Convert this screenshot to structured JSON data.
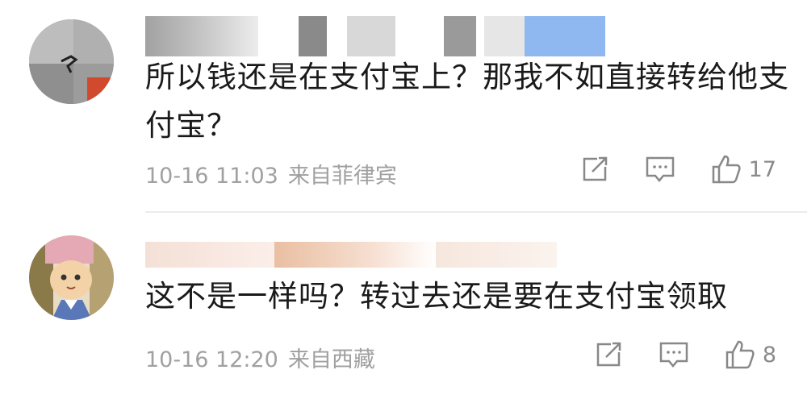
{
  "comments": [
    {
      "text": "所以钱还是在支付宝上？那我不如直接转给他支付宝？",
      "time": "10-16 11:03",
      "location": "来自菲律宾",
      "likes": "17"
    },
    {
      "text": "这不是一样吗？转过去还是要在支付宝领取",
      "time": "10-16 12:20",
      "location": "来自西藏",
      "likes": "8"
    }
  ],
  "icons": {
    "share": "share-icon",
    "reply": "comment-icon",
    "like": "thumbs-up-icon"
  }
}
